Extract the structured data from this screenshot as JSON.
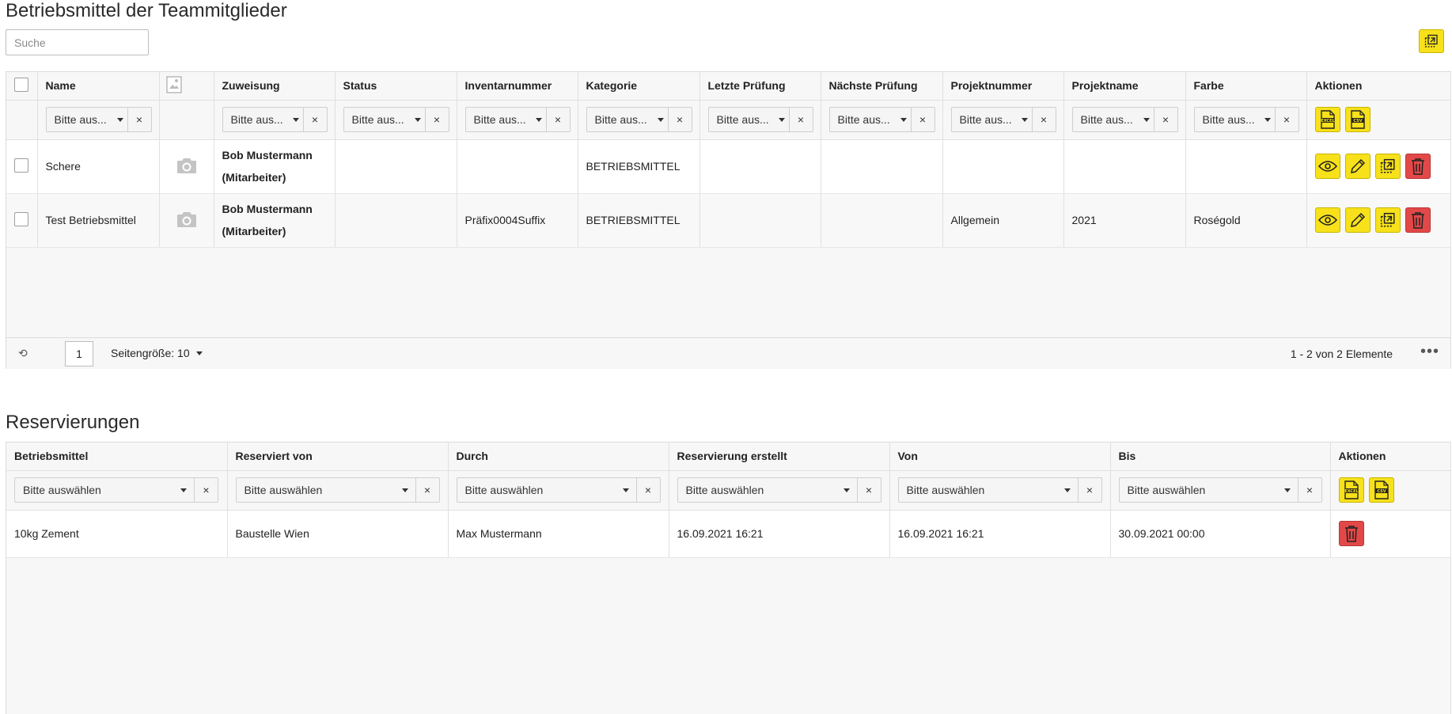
{
  "section1": {
    "title": "Betriebsmittel der Teammitglieder",
    "search_placeholder": "Suche",
    "columns": [
      "Name",
      "",
      "Zuweisung",
      "Status",
      "Inventarnummer",
      "Kategorie",
      "Letzte Prüfung",
      "Nächste Prüfung",
      "Projektnummer",
      "Projektname",
      "Farbe",
      "Aktionen"
    ],
    "filter_placeholder": "Bitte aus...",
    "filter_clear": "×",
    "rows": [
      {
        "name": "Schere",
        "zuweisung_name": "Bob Mustermann",
        "zuweisung_role": "(Mitarbeiter)",
        "status": "",
        "inventarnummer": "",
        "kategorie": "BETRIEBSMITTEL",
        "letzte": "",
        "naechste": "",
        "projektnummer": "",
        "projektname": "",
        "farbe": ""
      },
      {
        "name": "Test Betriebsmittel",
        "zuweisung_name": "Bob Mustermann",
        "zuweisung_role": "(Mitarbeiter)",
        "status": "",
        "inventarnummer": "Präfix0004Suffix",
        "kategorie": "BETRIEBSMITTEL",
        "letzte": "",
        "naechste": "",
        "projektnummer": "Allgemein",
        "projektname": "2021",
        "farbe": "Roségold"
      }
    ],
    "pager": {
      "page": "1",
      "page_size": "Seitengröße: 10",
      "info": "1 - 2 von 2 Elemente",
      "more": "•••"
    }
  },
  "section2": {
    "title": "Reservierungen",
    "columns": [
      "Betriebsmittel",
      "Reserviert von",
      "Durch",
      "Reservierung erstellt",
      "Von",
      "Bis",
      "Aktionen"
    ],
    "filter_placeholder": "Bitte auswählen",
    "filter_clear": "×",
    "rows": [
      {
        "betriebsmittel": "10kg Zement",
        "reserviert_von": "Baustelle Wien",
        "durch": "Max Mustermann",
        "erstellt": "16.09.2021 16:21",
        "von": "16.09.2021 16:21",
        "bis": "30.09.2021 00:00"
      }
    ]
  },
  "icons": {
    "excel_label": "EXCEL",
    "csv_label": "CSV"
  },
  "colors": {
    "accent_yellow": "#f7e11a",
    "danger_red": "#e34848"
  }
}
